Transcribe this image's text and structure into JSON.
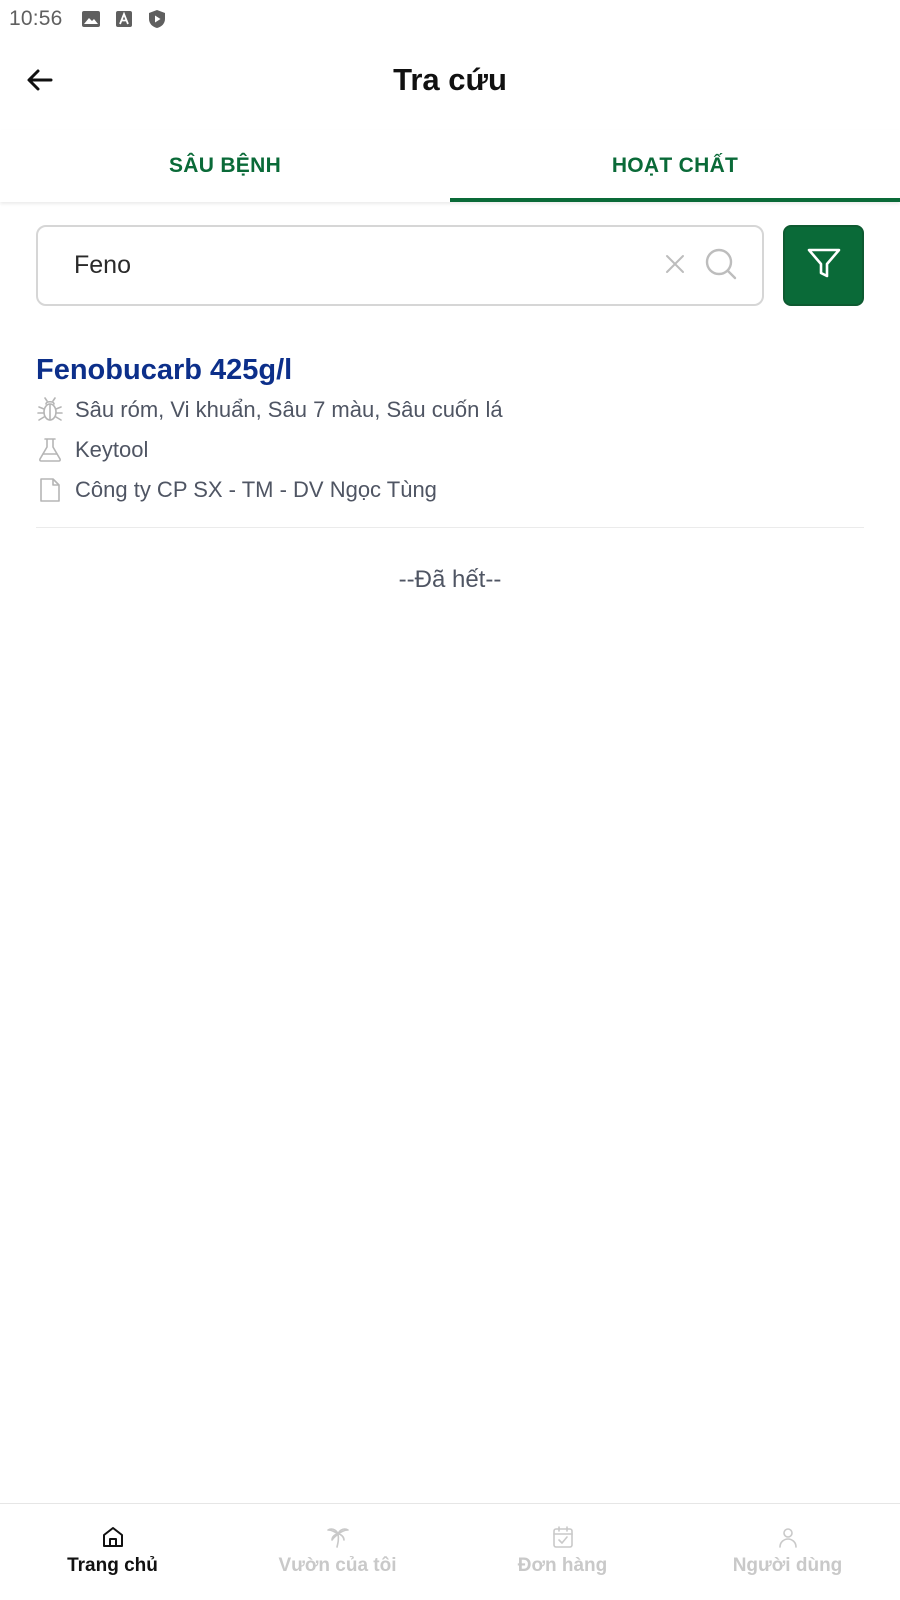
{
  "status_bar": {
    "time": "10:56",
    "icons": [
      "image-icon",
      "text-icon",
      "shield-play-icon"
    ]
  },
  "app_bar": {
    "back_icon": "arrow-left-icon",
    "title": "Tra cứu"
  },
  "tabs": [
    {
      "label": "SÂU BỆNH",
      "active": false
    },
    {
      "label": "HOẠT CHẤT",
      "active": true
    }
  ],
  "search": {
    "value": "Feno",
    "placeholder": "",
    "clear_icon": "close-icon",
    "search_icon": "search-icon",
    "filter_icon": "filter-icon"
  },
  "results": [
    {
      "title": "Fenobucarb 425g/l",
      "pests": "Sâu róm, Vi khuẩn, Sâu 7 màu, Sâu cuốn lá",
      "product": "Keytool",
      "company": "Công ty CP SX - TM - DV Ngọc Tùng"
    }
  ],
  "end_text": "--Đã hết--",
  "bottom_nav": [
    {
      "label": "Trang chủ",
      "icon": "home-icon",
      "active": true
    },
    {
      "label": "Vườn của tôi",
      "icon": "palm-tree-icon",
      "active": false
    },
    {
      "label": "Đơn hàng",
      "icon": "calendar-check-icon",
      "active": false
    },
    {
      "label": "Người dùng",
      "icon": "user-icon",
      "active": false
    }
  ],
  "colors": {
    "brand_green": "#0a6a38",
    "title_blue": "#0c2f8a",
    "meta_gray": "#4f5563",
    "inactive_nav": "#c9c9c9"
  }
}
